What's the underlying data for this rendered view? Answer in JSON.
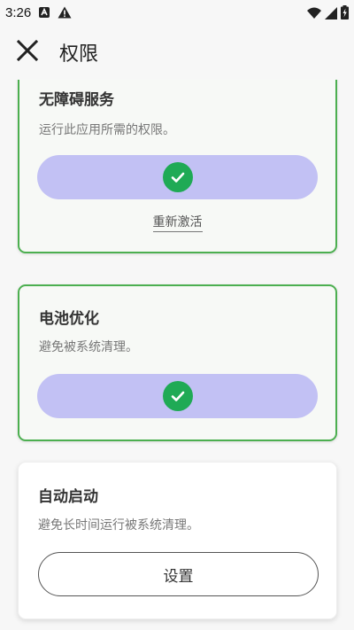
{
  "status_bar": {
    "time": "3:26",
    "left_icons": [
      "notification-a-icon",
      "warning-icon"
    ],
    "right_icons": [
      "wifi-icon",
      "signal-icon",
      "battery-charging-icon"
    ]
  },
  "app_bar": {
    "close_icon": "close-icon",
    "title": "权限"
  },
  "permissions": {
    "accessibility": {
      "title": "无障碍服务",
      "description": "运行此应用所需的权限。",
      "status": "granted",
      "reactivate_label": "重新激活"
    },
    "battery": {
      "title": "电池优化",
      "description": "避免被系统清理。",
      "status": "granted"
    },
    "autostart": {
      "title": "自动启动",
      "description": "避免长时间运行被系统清理。",
      "button_label": "设置"
    }
  },
  "colors": {
    "active_border": "#4caf50",
    "granted_pill": "#c2c1f4",
    "check_green": "#1faa55"
  }
}
